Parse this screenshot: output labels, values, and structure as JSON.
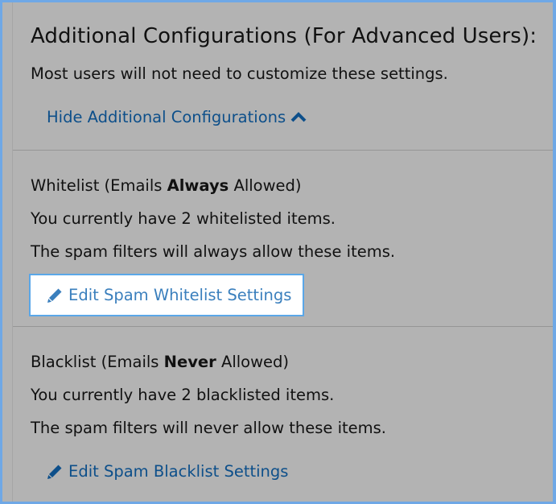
{
  "header": {
    "title": "Additional Configurations (For Advanced Users):",
    "description": "Most users will not need to customize these settings.",
    "toggle_label": "Hide Additional Configurations"
  },
  "whitelist": {
    "heading_prefix": "Whitelist (Emails ",
    "heading_emphasis": "Always",
    "heading_suffix": " Allowed)",
    "count_text": "You currently have 2 whitelisted items.",
    "info_text": "The spam filters will always allow these items.",
    "edit_label": "Edit Spam Whitelist Settings"
  },
  "blacklist": {
    "heading_prefix": "Blacklist (Emails ",
    "heading_emphasis": "Never",
    "heading_suffix": " Allowed)",
    "count_text": "You currently have 2 blacklisted items.",
    "info_text": "The spam filters will never allow these items.",
    "edit_label": "Edit Spam Blacklist Settings"
  },
  "icons": {
    "toggle": "chevron-up-icon",
    "edit": "pencil-icon"
  },
  "colors": {
    "background": "#b3b3b3",
    "link": "#0d4f8a",
    "button_text": "#3a7fbd",
    "button_border": "#5aa7e8",
    "frame_border": "#6fa8e6"
  }
}
